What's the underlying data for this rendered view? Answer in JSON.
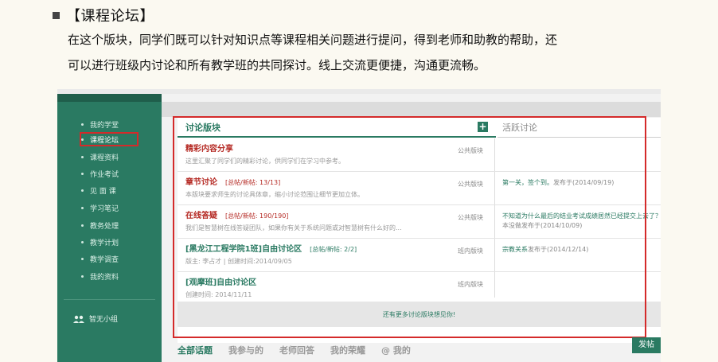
{
  "section": {
    "title": "【课程论坛】",
    "line1": "在这个版块，同学们既可以针对知识点等课程相关问题进行提问，得到老师和助教的帮助，还",
    "line2": "可以进行班级内讨论和所有教学班的共同探讨。线上交流更便捷，沟通更流畅。"
  },
  "sidebar": {
    "items": [
      {
        "label": "我的学堂"
      },
      {
        "label": "课程论坛"
      },
      {
        "label": "课程资料"
      },
      {
        "label": "作业考试"
      },
      {
        "label": "见 面 课"
      },
      {
        "label": "学习笔记"
      },
      {
        "label": "教务处理"
      },
      {
        "label": "教学计划"
      },
      {
        "label": "教学调查"
      },
      {
        "label": "我的资料"
      }
    ],
    "active_index": 1,
    "group_label": "智无小组"
  },
  "panel": {
    "title": "讨论版块",
    "activity_title": "活跃讨论",
    "add_symbol": "+",
    "more_text": "还有更多讨论版块想见你!",
    "rows": [
      {
        "title": "精彩内容分享",
        "counts": "",
        "desc": "这里汇聚了同学们的精彩讨论，供同学们在学习中参考。",
        "type": "公共版块",
        "activity": "",
        "activity_meta": ""
      },
      {
        "title": "章节讨论",
        "counts": "[总帖/新帖: 13/13]",
        "desc": "本版块要求师生的讨论具体章，缩小讨论范围让细节更加立体。",
        "type": "公共版块",
        "activity": "第一关，签个到。",
        "activity_meta": "发布于(2014/09/19)"
      },
      {
        "title": "在线答疑",
        "counts": "[总帖/新帖: 190/190]",
        "desc": "我们是智慧树在线答疑团队，如果你有关于系统问题或对智慧树有什么好的...",
        "type": "公共版块",
        "activity": "不知道为什么最后的结业考试成绩居然已经提交上去了？",
        "activity_meta": "本没做发布于(2014/10/09)"
      },
      {
        "title": "[黑龙江工程学院1班]自由讨论区",
        "counts": "[总帖/新帖: 2/2]",
        "desc": "版主: 李占才 | 创建时间:2014/09/05",
        "type": "班内版块",
        "activity": "宗教关系",
        "activity_meta": "发布于(2014/12/14)"
      },
      {
        "title": "[观摩班]自由讨论区",
        "counts": "",
        "desc": "创建时间: 2014/11/11",
        "type": "班内版块",
        "activity": "",
        "activity_meta": ""
      }
    ]
  },
  "tabs": [
    "全部话题",
    "我参与的",
    "老师回答",
    "我的荣耀",
    "@ 我的"
  ],
  "post_button": "发帖",
  "colors": {
    "accent": "#2a7a62",
    "highlight": "#d42a2a",
    "title_red": "#b52a24"
  }
}
